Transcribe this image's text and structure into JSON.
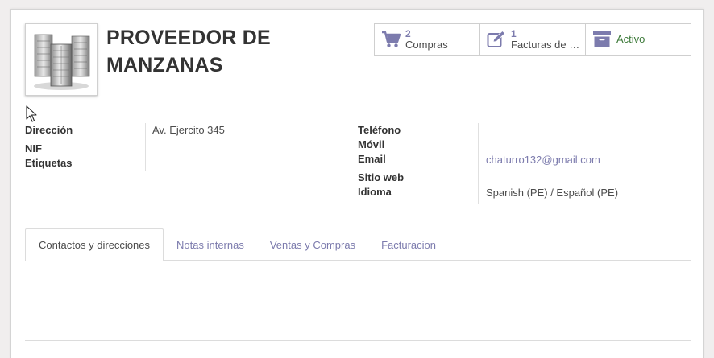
{
  "partner": {
    "name": "PROVEEDOR DE MANZANAS",
    "avatar_icon": "buildings-icon"
  },
  "smart_buttons": [
    {
      "count": "2",
      "label": "Compras",
      "icon": "cart-icon"
    },
    {
      "count": "1",
      "label": "Facturas de proveedor",
      "icon": "edit-icon"
    },
    {
      "label": "Activo",
      "icon": "archive-icon"
    }
  ],
  "fields_left": {
    "address_label": "Dirección",
    "address_value": "Av. Ejercito 345",
    "nif_label": "NIF",
    "tags_label": "Etiquetas"
  },
  "fields_right": {
    "phone_label": "Teléfono",
    "mobile_label": "Móvil",
    "email_label": "Email",
    "email_value": "chaturro132@gmail.com",
    "website_label": "Sitio web",
    "language_label": "Idioma",
    "language_value": "Spanish (PE) / Español (PE)"
  },
  "tabs": [
    {
      "label": "Contactos y direcciones",
      "active": true
    },
    {
      "label": "Notas internas",
      "active": false
    },
    {
      "label": "Ventas y Compras",
      "active": false
    },
    {
      "label": "Facturacion",
      "active": false
    }
  ],
  "colors": {
    "accent": "#7c7bad",
    "active_green": "#3d7a3a"
  }
}
